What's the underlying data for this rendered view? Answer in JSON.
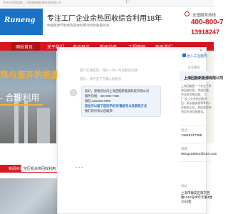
{
  "topbar": {
    "text": "空压机余热回收_上海回能新能源科技有限公司",
    "mark": "V"
  },
  "header": {
    "logo_text": "Runeng",
    "title": "专注工厂企业余热回收综合利用18年",
    "subtitle1": "中国能源节能余热回收利用项目优质服务商",
    "subtitle2": "",
    "hotline_label": "全国服务热线",
    "hotline1": "400-800-7",
    "hotline2": "13918247"
  },
  "nav": {
    "items": [
      "网站首页",
      "关于我们",
      "产品展示",
      "新闻动态",
      "工程案例",
      "联系我们"
    ]
  },
  "hero": {
    "line1": "热与废弃的能量",
    "line2": "- 合理利用"
  },
  "news": {
    "tab_active": "新闻资讯",
    "tab_other": "空压机余热回收利用"
  },
  "chat": {
    "hint1": "客户在线咨询，我们一对一为您解答问题",
    "hint2": "您好，请点击下方输入框留言",
    "msg": [
      "您好，感谢您访问上海回能新能源科技有限公司",
      "服务热线：400-800-7390",
      "微信:13918247995",
      "您也可以留下您的手机号/微信号以及联系方式",
      "我们将尽快与您联系！"
    ],
    "dots": "•••"
  },
  "side": {
    "header": "进入工业服务",
    "label": "企业图标",
    "company": "上海回能新能源有限公司",
    "intro": "上海回能是一个专业于余热回收利用，余热回收、空压机余热回收、\"工厂\"及工业余热回收项目，热水器安装等等的一家服务企业，热回收综合利用专业回收服务。",
    "phone_label": "电话",
    "phone": "13918247995",
    "email_label": "邮箱",
    "email": "sklng158801@163.com",
    "addr_label": "地址",
    "addr": "上海市静安区南京西路1018号中华大厦4楼1018室"
  },
  "colors": {
    "brand_red": "#d71720",
    "accent_blue": "#2a6bd1",
    "gold": "#f2b233"
  }
}
